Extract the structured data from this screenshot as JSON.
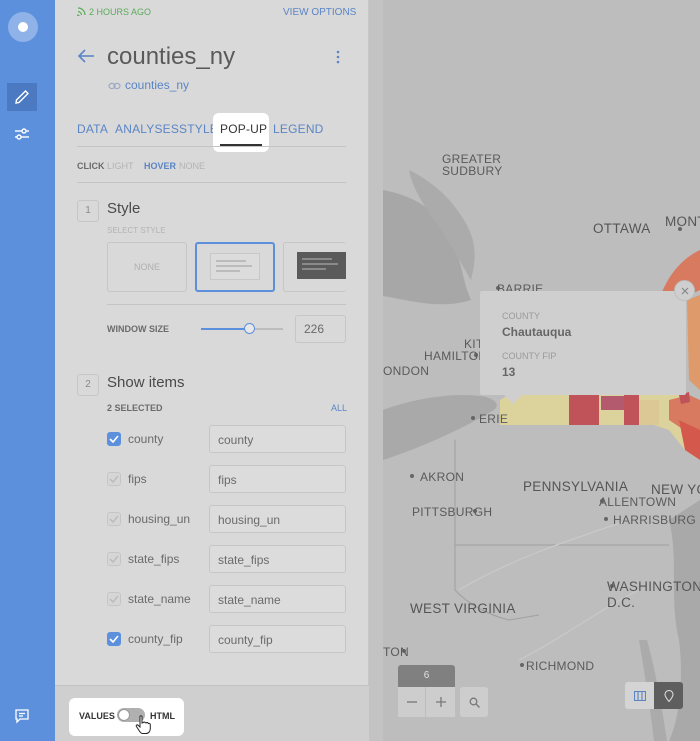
{
  "panel": {
    "live_text": "2 HOURS AGO",
    "view_options": "VIEW OPTIONS",
    "title": "counties_ny",
    "source": "counties_ny",
    "tabs": [
      "DATA",
      "ANALYSES",
      "STYLE",
      "POP-UP",
      "LEGEND"
    ],
    "active_tab": "POP-UP",
    "click_label": "CLICK",
    "click_value": "LIGHT",
    "hover_label": "HOVER",
    "hover_value": "NONE"
  },
  "style_section": {
    "number": "1",
    "title": "Style",
    "subtitle": "SELECT STYLE",
    "none_label": "NONE",
    "window_size_label": "WINDOW SIZE",
    "window_size_value": "226",
    "window_size_level": 0.5
  },
  "items_section": {
    "number": "2",
    "title": "Show items",
    "selected_text": "2 SELECTED",
    "all_link": "ALL",
    "fields": [
      {
        "name": "county",
        "value": "county",
        "checked": true
      },
      {
        "name": "fips",
        "value": "fips",
        "checked": false
      },
      {
        "name": "housing_un",
        "value": "housing_un",
        "checked": false
      },
      {
        "name": "state_fips",
        "value": "state_fips",
        "checked": false
      },
      {
        "name": "state_name",
        "value": "state_name",
        "checked": false
      },
      {
        "name": "county_fip",
        "value": "county_fip",
        "checked": true
      }
    ]
  },
  "footer": {
    "values_label": "VALUES",
    "html_label": "HTML"
  },
  "popup": {
    "field1_label": "COUNTY",
    "field1_value": "Chautauqua",
    "field2_label": "COUNTY FIP",
    "field2_value": "13"
  },
  "map": {
    "labels": [
      "GREATER",
      "SUDBURY",
      "OTTAWA",
      "MONT",
      "BARRIE",
      "KIT",
      "HAMILTON",
      "ONDON",
      "ERIE",
      "AKRON",
      "PENNSYLVANIA",
      "NEW YO",
      "ALLENTOWN",
      "PITTSBURGH",
      "HARRISBURG",
      "WASHINGTON",
      "D.C.",
      "WEST VIRGINIA",
      "TON",
      "RICHMOND"
    ],
    "zoom_level": "6"
  },
  "colors": {
    "accent": "#5c8fdc",
    "rail": "#5c8fdc",
    "choropleth_high": "#c0525a",
    "choropleth_mid": "#d77a60",
    "choropleth_low": "#dcd39c"
  }
}
